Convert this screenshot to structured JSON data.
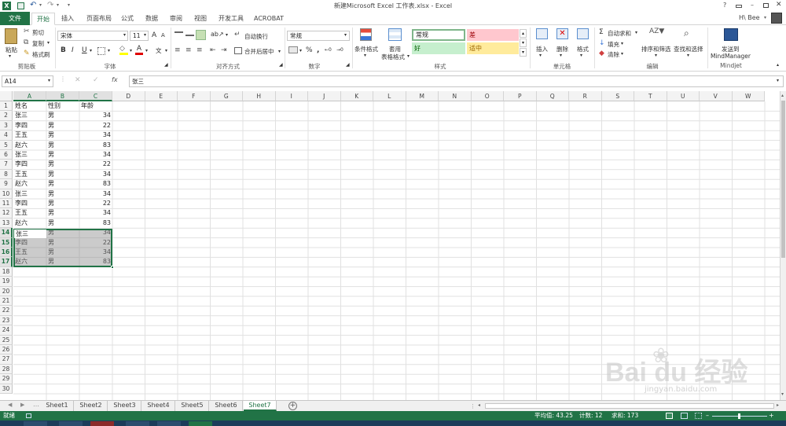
{
  "titlebar": {
    "title": "新建Microsoft Excel 工作表.xlsx - Excel",
    "user": "H\\ Bee",
    "help": "?"
  },
  "tabs": [
    "开始",
    "插入",
    "页面布局",
    "公式",
    "数据",
    "审阅",
    "视图",
    "开发工具",
    "ACROBAT"
  ],
  "file_tab": "文件",
  "ribbon": {
    "clipboard": {
      "paste": "粘贴",
      "cut": "剪切",
      "copy": "复制",
      "format_painter": "格式刷",
      "label": "剪贴板"
    },
    "font": {
      "name": "宋体",
      "size": "11",
      "label": "字体",
      "bold": "B",
      "italic": "I",
      "underline": "U",
      "grow": "A",
      "shrink": "A",
      "wen": "文"
    },
    "align": {
      "wrap": "自动换行",
      "merge": "合并后居中",
      "label": "对齐方式"
    },
    "number": {
      "format": "常规",
      "percent": "%",
      "label": "数字"
    },
    "styles": {
      "conditional": "条件格式",
      "table": [
        "套用",
        "表格格式"
      ],
      "normal": "常规",
      "bad": "差",
      "good": "好",
      "neutral": "适中",
      "label": "样式"
    },
    "cells": {
      "insert": "插入",
      "delete": "删除",
      "format": "格式",
      "label": "单元格"
    },
    "editing": {
      "autosum": "自动求和",
      "fill": "填充",
      "clear": "清除",
      "sort": "排序和筛选",
      "find": "查找和选择",
      "label": "编辑"
    },
    "mindjet": {
      "send": [
        "发送到",
        "MindManager"
      ],
      "label": "Mindjet"
    }
  },
  "formula_bar": {
    "name_box": "A14",
    "fx": "fx",
    "content": "张三"
  },
  "columns": [
    "A",
    "B",
    "C",
    "D",
    "E",
    "F",
    "G",
    "H",
    "I",
    "J",
    "K",
    "L",
    "M",
    "N",
    "O",
    "P",
    "Q",
    "R",
    "S",
    "T",
    "U",
    "V",
    "W"
  ],
  "header_row": [
    "姓名",
    "性别",
    "年龄"
  ],
  "rows": [
    [
      "张三",
      "男",
      "34"
    ],
    [
      "李四",
      "男",
      "22"
    ],
    [
      "王五",
      "男",
      "34"
    ],
    [
      "赵六",
      "男",
      "83"
    ],
    [
      "张三",
      "男",
      "34"
    ],
    [
      "李四",
      "男",
      "22"
    ],
    [
      "王五",
      "男",
      "34"
    ],
    [
      "赵六",
      "男",
      "83"
    ],
    [
      "张三",
      "男",
      "34"
    ],
    [
      "李四",
      "男",
      "22"
    ],
    [
      "王五",
      "男",
      "34"
    ],
    [
      "赵六",
      "男",
      "83"
    ],
    [
      "张三",
      "男",
      "34"
    ],
    [
      "李四",
      "男",
      "22"
    ],
    [
      "王五",
      "男",
      "34"
    ],
    [
      "赵六",
      "男",
      "83"
    ]
  ],
  "row_numbers": [
    "1",
    "2",
    "3",
    "4",
    "5",
    "6",
    "7",
    "8",
    "9",
    "10",
    "11",
    "12",
    "13",
    "14",
    "15",
    "16",
    "17",
    "18",
    "19",
    "20",
    "21",
    "22",
    "23",
    "24",
    "25",
    "26",
    "27",
    "28",
    "29",
    "30"
  ],
  "sheets": [
    "Sheet1",
    "Sheet2",
    "Sheet3",
    "Sheet4",
    "Sheet5",
    "Sheet6",
    "Sheet7"
  ],
  "active_sheet": "Sheet7",
  "status": {
    "mode": "就绪",
    "average": "平均值: 43.25",
    "count": "计数: 12",
    "sum": "求和: 173"
  },
  "watermark": "Bai du 经验",
  "watermark_url": "jingyan.baidu.com",
  "colors": {
    "excel_green": "#217346",
    "selection_fill": "#c8c8c8",
    "bad_fill": "#ffc7ce",
    "good_fill": "#c6efce",
    "neutral_fill": "#ffeb9c"
  },
  "icons": [
    "excel-logo-icon",
    "save-icon",
    "undo-icon",
    "redo-icon",
    "paste-icon",
    "cut-icon",
    "copy-icon",
    "format-painter-icon",
    "new-sheet-icon",
    "zoom-minus-icon",
    "zoom-plus-icon"
  ]
}
